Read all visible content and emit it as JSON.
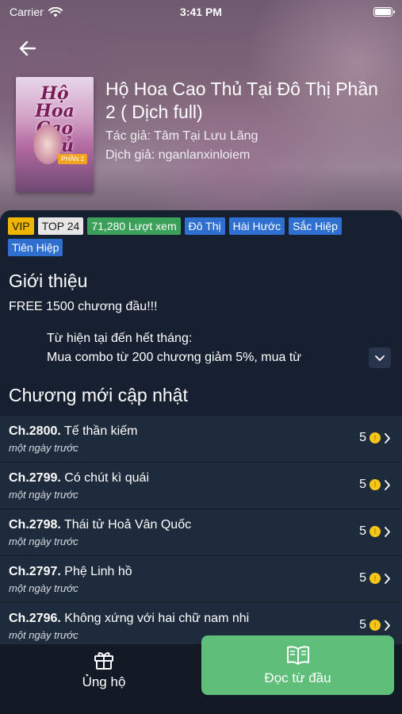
{
  "status_bar": {
    "carrier": "Carrier",
    "time": "3:41 PM"
  },
  "book": {
    "cover_text": "Hộ Hoa Cao Thủ",
    "cover_tag": "PHẦN 2",
    "title": "Hộ Hoa Cao Thủ Tại Đô Thị Phần 2 ( Dịch full)",
    "author": "Tác giả: Tâm Tại Lưu Lãng",
    "translator": "Dịch giả: nganlanxinloiem"
  },
  "tags": [
    {
      "label": "VIP",
      "kind": "vip"
    },
    {
      "label": "TOP 24",
      "kind": "top"
    },
    {
      "label": "71,280 Lượt xem",
      "kind": "views"
    },
    {
      "label": "Đô Thị",
      "kind": "genre"
    },
    {
      "label": "Hài Hước",
      "kind": "genre"
    },
    {
      "label": "Sắc Hiệp",
      "kind": "genre"
    },
    {
      "label": "Tiên Hiệp",
      "kind": "genre"
    }
  ],
  "intro": {
    "title": "Giới thiệu",
    "first_line": "FREE 1500 chương đầu!!!",
    "lines": [
      "Từ hiện tại đến hết tháng:",
      "Mua combo từ 200 chương giảm 5%, mua từ"
    ]
  },
  "chapters_section": {
    "title": "Chương mới cập nhật",
    "items": [
      {
        "number": "Ch.2800.",
        "name": "Tế thần kiếm",
        "time": "một ngày trước",
        "price": "5"
      },
      {
        "number": "Ch.2799.",
        "name": "Có chút kì quái",
        "time": "một ngày trước",
        "price": "5"
      },
      {
        "number": "Ch.2798.",
        "name": "Thái tử Hoả Vân Quốc",
        "time": "một ngày trước",
        "price": "5"
      },
      {
        "number": "Ch.2797.",
        "name": "Phệ Linh hồ",
        "time": "một ngày trước",
        "price": "5"
      },
      {
        "number": "Ch.2796.",
        "name": "Không xứng với hai chữ nam nhi",
        "time": "một ngày trước",
        "price": "5"
      }
    ]
  },
  "bottom_bar": {
    "support_label": "Ủng hộ",
    "read_label": "Đọc từ đầu"
  },
  "colors": {
    "panel_bg": "#162030",
    "row_bg": "#1e2b3d",
    "read_button": "#5fbf7a",
    "vip_tag": "#efb600",
    "views_tag": "#3aa05a",
    "genre_tag": "#2f6fcf",
    "coin": "#f5c518"
  },
  "icons": {
    "back": "arrow-left-icon",
    "expand": "chevron-down-icon",
    "chapter_arrow": "chevron-right-icon",
    "support": "gift-box-icon",
    "read": "open-book-icon"
  }
}
